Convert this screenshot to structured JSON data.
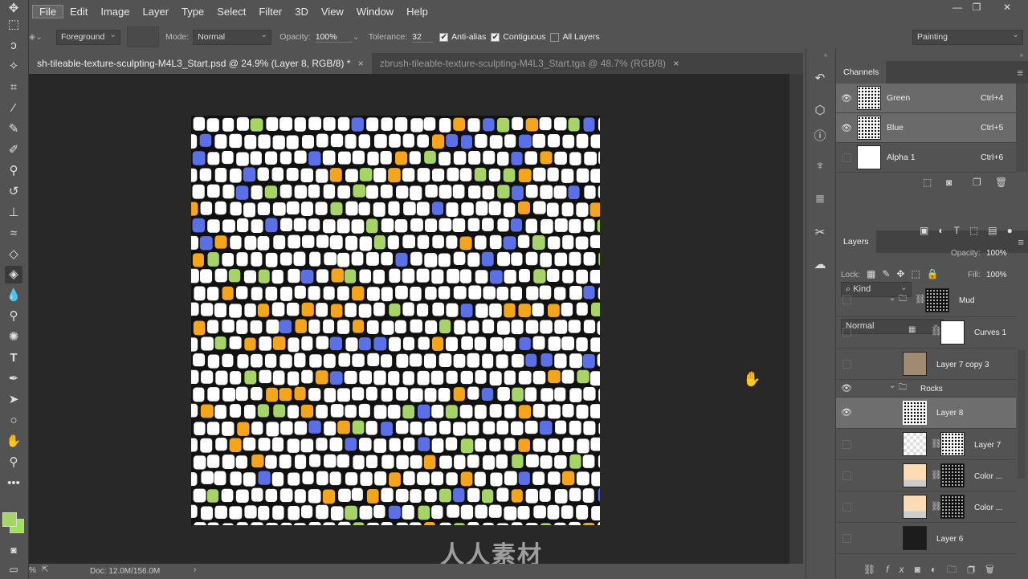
{
  "menu": {
    "items": [
      "File",
      "Edit",
      "Image",
      "Layer",
      "Type",
      "Select",
      "Filter",
      "3D",
      "View",
      "Window",
      "Help"
    ]
  },
  "window_controls": [
    "minimize",
    "restore",
    "close"
  ],
  "options": {
    "fill_source": "Foreground",
    "mode_label": "Mode:",
    "mode": "Normal",
    "opacity_label": "Opacity:",
    "opacity": "100%",
    "tolerance_label": "Tolerance:",
    "tolerance": "32",
    "anti_alias": {
      "label": "Anti-alias",
      "checked": true
    },
    "contiguous": {
      "label": "Contiguous",
      "checked": true
    },
    "all_layers": {
      "label": "All Layers",
      "checked": false
    },
    "workspace": "Painting"
  },
  "tabs": [
    {
      "label": "sh-tileable-texture-sculpting-M4L3_Start.psd @ 24.9% (Layer 8, RGB/8) *",
      "close": "×",
      "active": true
    },
    {
      "label": "zbrush-tileable-texture-sculpting-M4L3_Start.tga @ 48.7% (RGB/8)",
      "close": "×",
      "active": false
    }
  ],
  "status": {
    "zoom": "%",
    "doc": "Doc: 12.0M/156.0M"
  },
  "canvas": {
    "colors": {
      "tile": "#ffffff",
      "orange": "#f5a51c",
      "blue": "#5b6fe6",
      "green": "#a6d466",
      "grout": "#111111"
    }
  },
  "watermark": "人人素材",
  "channels": {
    "title": "Channels",
    "rows": [
      {
        "name": "Green",
        "shortcut": "Ctrl+4",
        "visible": true
      },
      {
        "name": "Blue",
        "shortcut": "Ctrl+5",
        "visible": true
      },
      {
        "name": "Alpha 1",
        "shortcut": "Ctrl+6",
        "visible": false
      }
    ]
  },
  "layers": {
    "title": "Layers",
    "filter": "Kind",
    "blend": "Normal",
    "opacity_label": "Opacity:",
    "opacity": "100%",
    "lock_label": "Lock:",
    "fill_label": "Fill:",
    "fill": "100%",
    "rows": [
      {
        "name": "Mud",
        "type": "group",
        "visible": false
      },
      {
        "name": "Curves 1",
        "type": "adjustment",
        "visible": false
      },
      {
        "name": "Layer 7 copy 3",
        "type": "pixel",
        "visible": false
      },
      {
        "name": "Rocks",
        "type": "group",
        "visible": true
      },
      {
        "name": "Layer 8",
        "type": "pixel",
        "visible": true,
        "selected": true
      },
      {
        "name": "Layer 7",
        "type": "pixel",
        "visible": false
      },
      {
        "name": "Color ...",
        "type": "fill",
        "visible": false
      },
      {
        "name": "Color ...",
        "type": "fill",
        "visible": false
      },
      {
        "name": "Layer 6",
        "type": "pixel",
        "visible": false
      }
    ]
  }
}
